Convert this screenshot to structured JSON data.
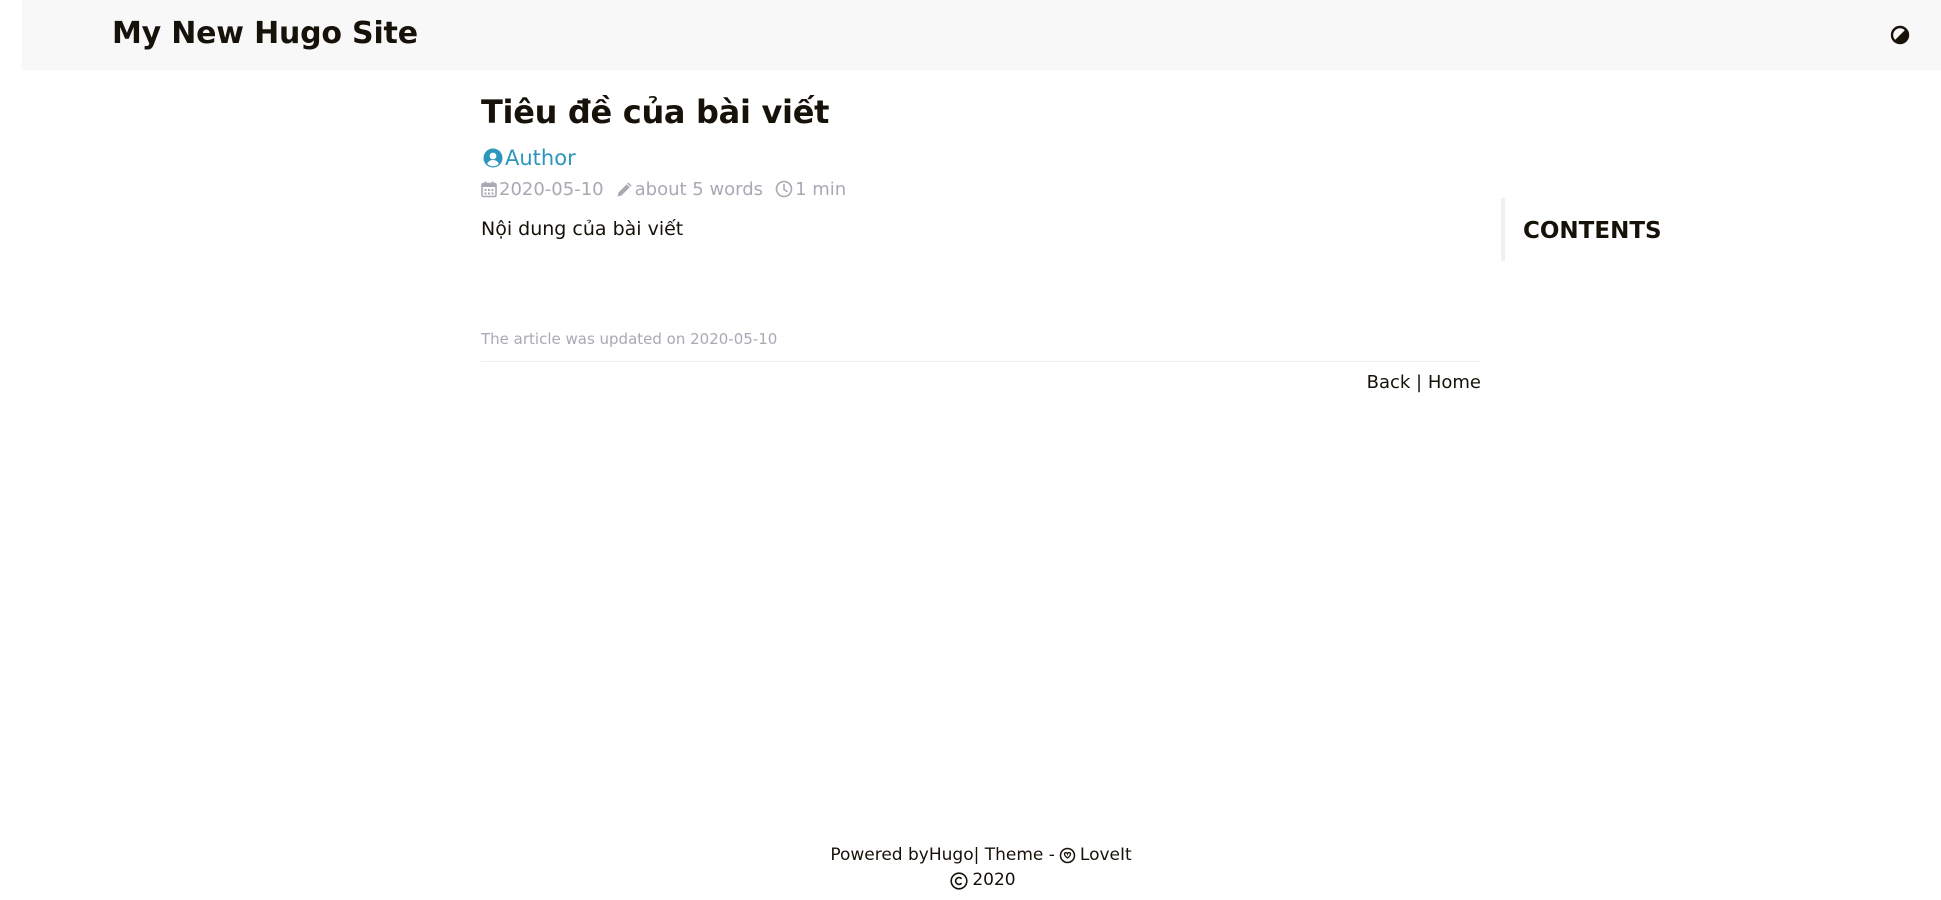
{
  "header": {
    "site_title": "My New Hugo Site",
    "theme_switch_icon": "half-circle-contrast-icon"
  },
  "article": {
    "title": "Tiêu đề của bài viết",
    "author": "Author",
    "date": "2020-05-10",
    "word_count": "about 5 words",
    "reading_time": "1 min",
    "content": "Nội dung của bài viết",
    "updated": "The article was updated on 2020-05-10",
    "back_label": "Back",
    "separator": " | ",
    "home_label": "Home"
  },
  "toc": {
    "title": "CONTENTS"
  },
  "footer": {
    "powered_by_prefix": "Powered by ",
    "hugo_link": "Hugo",
    "theme_prefix": " | Theme - ",
    "theme_link": "LoveIt",
    "copyright_year": "2020"
  },
  "colors": {
    "link_accent": "#2d96bd",
    "meta_gray": "#a9a9b3",
    "text": "#161209",
    "header_bg": "#f8f8f8"
  }
}
